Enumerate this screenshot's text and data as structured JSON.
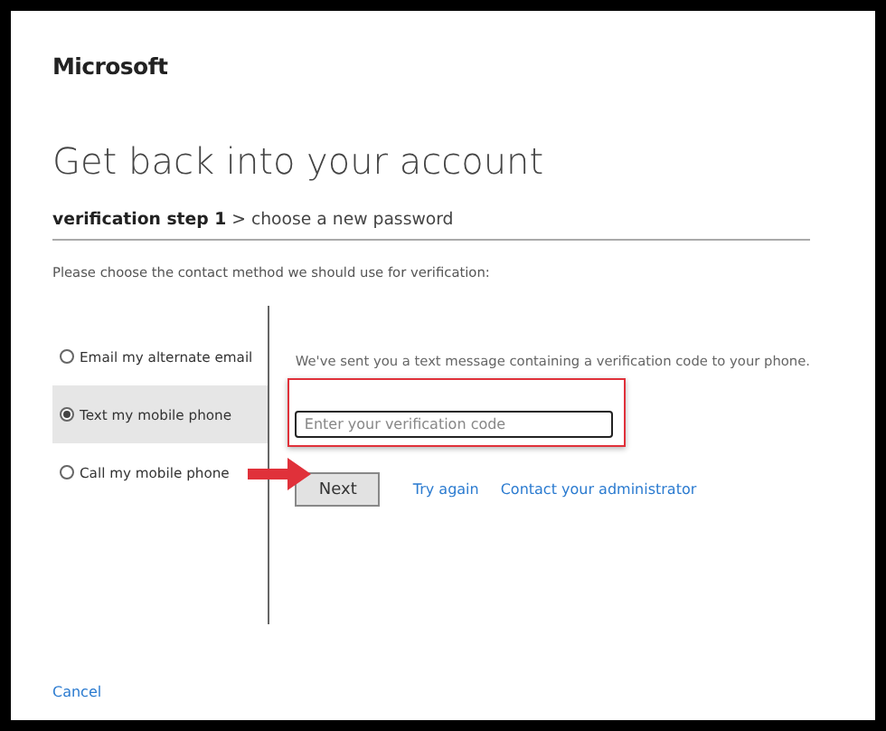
{
  "brand": "Microsoft",
  "title": "Get back into your account",
  "breadcrumb": "**verification step 1** > choose a new password",
  "instruction": "Please choose the contact method we should use for verification:",
  "methods": [
    {
      "label": "Email my alternate email",
      "selected": false
    },
    {
      "label": "Text my mobile phone",
      "selected": true
    },
    {
      "label": "Call my mobile phone",
      "selected": false
    }
  ],
  "panel": {
    "message": "We've sent you a text message containing a verification code to your phone.",
    "code_field": {
      "placeholder": "Enter your verification code"
    },
    "next_button": "Next",
    "links": [
      "Try again",
      "Contact your administrator"
    ]
  },
  "cancel": "Cancel"
}
